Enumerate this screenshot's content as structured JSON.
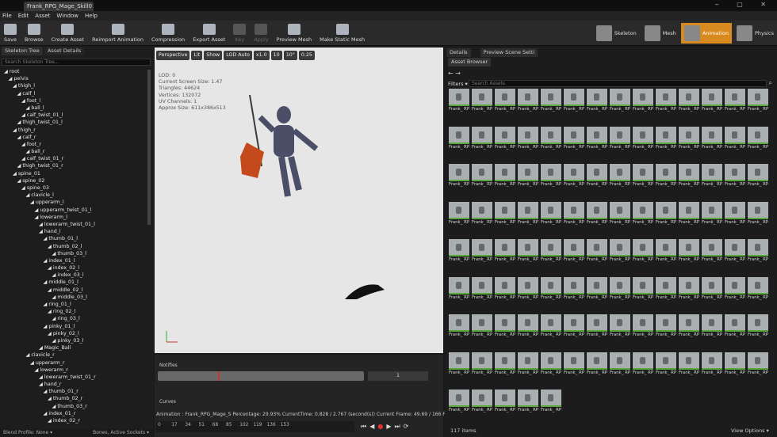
{
  "window": {
    "tab_title": "Frank_RPG_Mage_Skill0",
    "controls": "‒ ▢ ✕"
  },
  "menu": [
    "File",
    "Edit",
    "Asset",
    "Window",
    "Help"
  ],
  "toolbar": [
    "Save",
    "Browse",
    "Create Asset",
    "Reimport Animation",
    "Compression",
    "Export Asset",
    "Key",
    "Apply",
    "Preview Mesh",
    "Make Static Mesh"
  ],
  "modes": [
    {
      "label": "Skeleton",
      "active": false
    },
    {
      "label": "Mesh",
      "active": false
    },
    {
      "label": "Animation",
      "active": true
    },
    {
      "label": "Physics",
      "active": false
    }
  ],
  "left_panel": {
    "tabs": [
      "Skeleton Tree",
      "Asset Details"
    ],
    "search_placeholder": "Search Skeleton Tree...",
    "footer_left": "Blend Profile: None ▾",
    "footer_right": "Bones, Active Sockets ▾"
  },
  "bones": [
    [
      "root",
      0
    ],
    [
      "pelvis",
      1
    ],
    [
      "thigh_l",
      2
    ],
    [
      "calf_l",
      3
    ],
    [
      "foot_l",
      4
    ],
    [
      "ball_l",
      5
    ],
    [
      "calf_twist_01_l",
      4
    ],
    [
      "thigh_twist_01_l",
      3
    ],
    [
      "thigh_r",
      2
    ],
    [
      "calf_r",
      3
    ],
    [
      "foot_r",
      4
    ],
    [
      "ball_r",
      5
    ],
    [
      "calf_twist_01_r",
      4
    ],
    [
      "thigh_twist_01_r",
      3
    ],
    [
      "spine_01",
      2
    ],
    [
      "spine_02",
      3
    ],
    [
      "spine_03",
      4
    ],
    [
      "clavicle_l",
      5
    ],
    [
      "upperarm_l",
      6
    ],
    [
      "upperarm_twist_01_l",
      7
    ],
    [
      "lowerarm_l",
      7
    ],
    [
      "lowerarm_twist_01_l",
      8
    ],
    [
      "hand_l",
      8
    ],
    [
      "thumb_01_l",
      9
    ],
    [
      "thumb_02_l",
      10
    ],
    [
      "thumb_03_l",
      11
    ],
    [
      "index_01_l",
      9
    ],
    [
      "index_02_l",
      10
    ],
    [
      "index_03_l",
      11
    ],
    [
      "middle_01_l",
      9
    ],
    [
      "middle_02_l",
      10
    ],
    [
      "middle_03_l",
      11
    ],
    [
      "ring_01_l",
      9
    ],
    [
      "ring_02_l",
      10
    ],
    [
      "ring_03_l",
      11
    ],
    [
      "pinky_01_l",
      9
    ],
    [
      "pinky_02_l",
      10
    ],
    [
      "pinky_03_l",
      11
    ],
    [
      "Magic_Ball",
      8
    ],
    [
      "clavicle_r",
      5
    ],
    [
      "upperarm_r",
      6
    ],
    [
      "lowerarm_r",
      7
    ],
    [
      "lowerarm_twist_01_r",
      8
    ],
    [
      "hand_r",
      8
    ],
    [
      "thumb_01_r",
      9
    ],
    [
      "thumb_02_r",
      10
    ],
    [
      "thumb_03_r",
      11
    ],
    [
      "index_01_r",
      9
    ],
    [
      "index_02_r",
      10
    ]
  ],
  "viewport": {
    "buttons": [
      "Perspective",
      "Lit",
      "Show",
      "LOD Auto",
      "x1.0",
      "10",
      "10°",
      "0.25"
    ],
    "stats": [
      "LOD: 0",
      "Current Screen Size: 1.47",
      "Triangles: 44624",
      "Vertices: 132072",
      "UV Channels: 1",
      "Approx Size: 611x386x513"
    ]
  },
  "timeline": {
    "notifies": "Notifies",
    "curves": "Curves",
    "track_value": "1",
    "status": "Animation : Frank_RPG_Mage_S Percentage: 29.93% CurrentTime: 0.828 / 2.767 (second(s)) Current Frame: 49.69 / 166 Frame",
    "ruler": [
      "0",
      "17",
      "34",
      "51",
      "68",
      "85",
      "102",
      "119",
      "136",
      "153"
    ]
  },
  "right_panel": {
    "tabs": [
      "Details",
      "Preview Scene Setti"
    ],
    "subtab": "Asset Browser",
    "filters": "Filters ▾",
    "search_placeholder": "Search Assets",
    "items_count": "117 items",
    "view_options": "View Options ▾"
  },
  "assets": [
    [
      "Frank_ RPG_ Mage",
      "Frank_ RPG_ Mage",
      "Frank_ RPG_ Mage",
      "Frank_ RPG_ Mage",
      "Frank_ RPG_ Mage",
      "Frank_ RPG_ Mage",
      "Frank_ RPG_ Mage",
      "Frank_ RPG_ Mage",
      "Frank_ RPG_ Mage",
      "Frank_ RPG_ Mage",
      "Frank_ RPG_ Mage",
      "Frank_ RPG_ Mage",
      "Frank_ RPG_ Mage",
      "Frank_ RPG_ Mage"
    ],
    [
      "Frank_ RPG_ Mage",
      "Frank_ RPG_ Mage",
      "Frank_ RPG_ Mage",
      "Frank_ RPG_ Mage",
      "Frank_ RPG_ Mage",
      "Frank_ RPG_ Mage",
      "Frank_ RPG_ Mage",
      "Frank_ RPG_ Mage Hit",
      "Frank_ RPG_ Mage Hit",
      "Frank_ RPG_ Mage",
      "Frank_ RPG_ Mage",
      "Frank_ RPG_ Mage",
      "Frank_ RPG_ Mage",
      "Frank_ RPG_ Mage"
    ],
    [
      "Frank_ RPG_ Mage",
      "Frank_ RPG_ Mage",
      "Frank_ RPG_ Mage Stea",
      "Frank_ RPG_ Mage Stea",
      "Frank_ RPG_ Mage Stea",
      "Frank_ RPG_ Mage Stea",
      "Frank_ RPG_Idle",
      "Frank_ RPG_ Mage 4",
      "Frank_ RPG_ Mage 4",
      "Frank_ RPG_ Mage 4",
      "Frank_ RPG_ Mage 4",
      "Frank_ RPG_ Mage 4",
      "Frank_ RPG_ Mage 8",
      "Frank_ RPG_ Mage 8"
    ],
    [
      "Frank_ RPG_ Mage 8",
      "Frank_ RPG_ Mage 8",
      "Frank_ RPG_ Mage 8",
      "Frank_ RPG_ Mage 8",
      "Frank_ RPG_ Mage 8",
      "Frank_ RPG_ Mage 8",
      "Frank_ RPG_ Mage 8",
      "Frank_ RPG_ Mage 8",
      "Frank_ RPG_ Mage 8",
      "Frank_ RPG_ Mage 8",
      "Frank_ RPG_ Mage 8",
      "Frank_ RPG_ Mage 8",
      "Frank_ RPG_ Mage 8",
      "Frank_ RPG_ Mage 8"
    ],
    [
      "Frank_ RPG_ Mage",
      "Frank_ RPG_ Mage",
      "Frank_ RPG_ Mage",
      "Frank_ RPG_ Mage",
      "Frank_ RPG_ Mage",
      "Frank_ RPG_ Mage",
      "Frank_ RPG_ Mage",
      "Frank_ RPG_ Mage",
      "Frank_ RPG_ Mage",
      "Frank_ RPG_ Mage",
      "Frank_ RPG_ Mage",
      "Frank_ RPG_ Mage",
      "Frank_ RPG_ Mage",
      "Frank_ RPG_ Mage"
    ],
    [
      "Frank_ RPG_ Mage",
      "Frank_ RPG_ Mage",
      "Frank_ RPG_ Mage",
      "Frank_ RPG_ Mage",
      "Frank_ RPG_ Mage",
      "Frank_ RPG_ Mage",
      "Frank_ RPG_ Mage",
      "Frank_ RPG_ Mage",
      "Frank_ RPG_ Mage",
      "Frank_ RPG_ Mage Gre",
      "Frank_ RPG_ Mage",
      "Frank_ RPG_ Mage",
      "Frank_ RPG_ Mage",
      "Frank_ RPG_ Mage"
    ],
    [
      "Frank_ RPG_ Mage",
      "Frank_ RPG_ Mage",
      "Frank_ RPG_ Mage",
      "Frank_ RPG_ Mage",
      "Frank_ RPG_ Mage",
      "Frank_ RPG_ Mage",
      "Frank_ RPG_ Mage",
      "Frank_ RPG_ Mage Hit",
      "Frank_ RPG_ Mage Hit",
      "Frank_ RPG_ Mage Hit",
      "Frank_ RPG_ Mage Idle",
      "Frank_ RPG_ Mage",
      "Frank_ RPG_ Mage",
      "Frank_ RPG_ Mage"
    ],
    [
      "Frank_ RPG_ Mage",
      "Frank_ RPG_ Mage",
      "Frank_ RPG_ Mage",
      "Frank_ RPG_ Mage",
      "Frank_ RPG_ Mage",
      "Frank_ RPG_ Mage",
      "Frank_ RPG_ Mage",
      "Frank_ RPG_ Mage",
      "Frank_ RPG_ Mage",
      "Frank_ RPG_ Mage",
      "Frank_ RPG_ Mage Stea",
      "Frank_ RPG_ Mage Stea",
      "Frank_ RPG_ Mage Stea",
      "Frank_ RPG_ Mage"
    ],
    [
      "Frank_ RPG_ Mage Stea",
      "Frank_ RPG_ Mage",
      "Frank_ RPG_Run",
      "Frank_ RPG_Run",
      "Frank_ RPG_Run Faster"
    ]
  ],
  "colors": {
    "accent": "#d98a1f",
    "thumb_border": "#5aa83c"
  }
}
